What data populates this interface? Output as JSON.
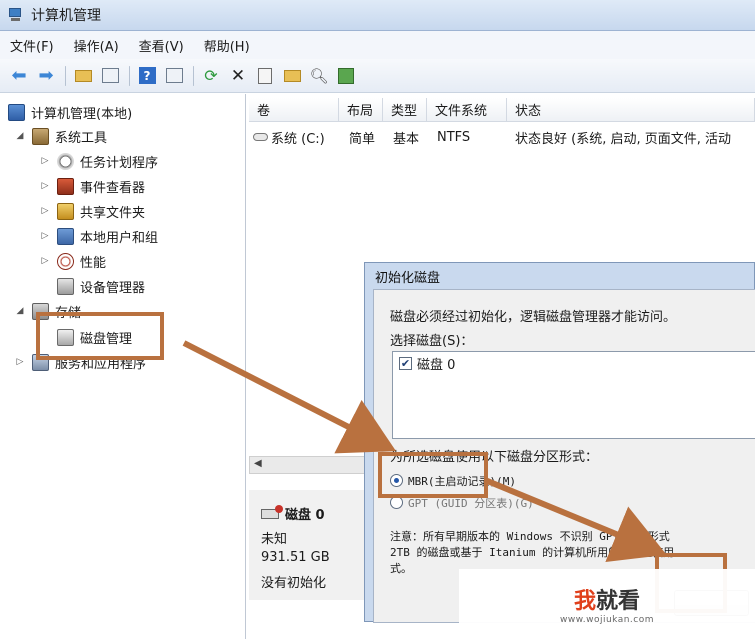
{
  "window": {
    "title": "计算机管理"
  },
  "menu": [
    "文件(F)",
    "操作(A)",
    "查看(V)",
    "帮助(H)"
  ],
  "toolbar_icons": [
    "back-arrow-icon",
    "forward-arrow-icon",
    "up-folder-icon",
    "show-hide-tree-icon",
    "help-icon",
    "action-pane-icon",
    "refresh-icon",
    "delete-icon",
    "properties-icon",
    "open-folder-icon",
    "search-icon",
    "disk-properties-icon"
  ],
  "tree": {
    "root": "计算机管理(本地)",
    "system_tools": "系统工具",
    "task_scheduler": "任务计划程序",
    "event_viewer": "事件查看器",
    "shared_folders": "共享文件夹",
    "local_users": "本地用户和组",
    "performance": "性能",
    "device_manager": "设备管理器",
    "storage": "存储",
    "disk_management": "磁盘管理",
    "services_apps": "服务和应用程序"
  },
  "volume_table": {
    "headers": [
      "卷",
      "布局",
      "类型",
      "文件系统",
      "状态"
    ],
    "rows": [
      {
        "volume": "系统 (C:)",
        "layout": "简单",
        "type": "基本",
        "fs": "NTFS",
        "status": "状态良好 (系统, 启动, 页面文件, 活动"
      }
    ]
  },
  "disk_panel": {
    "name": "磁盘 0",
    "type": "未知",
    "size": "931.51 GB",
    "state": "没有初始化"
  },
  "dialog": {
    "title": "初始化磁盘",
    "message": "磁盘必须经过初始化，逻辑磁盘管理器才能访问。",
    "select_label": "选择磁盘(S)：",
    "disk_item": "磁盘 0",
    "partition_label": "为所选磁盘使用以下磁盘分区形式：",
    "mbr_option": "MBR(主启动记录)(M)",
    "gpt_option": "GPT (GUID 分区表)(G)",
    "note_line1": "注意：所有早期版本的 Windows 不识别 GPT 分区形式",
    "note_line2": "2TB 的磁盘或基于 Itanium 的计算机所用的磁盘上使用",
    "note_line3": "式。"
  },
  "watermark": {
    "logo_red": "我",
    "logo_rest": "就看",
    "url": "www.wojiukan.com"
  },
  "colors": {
    "annotation": "#b9713f",
    "titlebar": "#c7d8ee"
  }
}
